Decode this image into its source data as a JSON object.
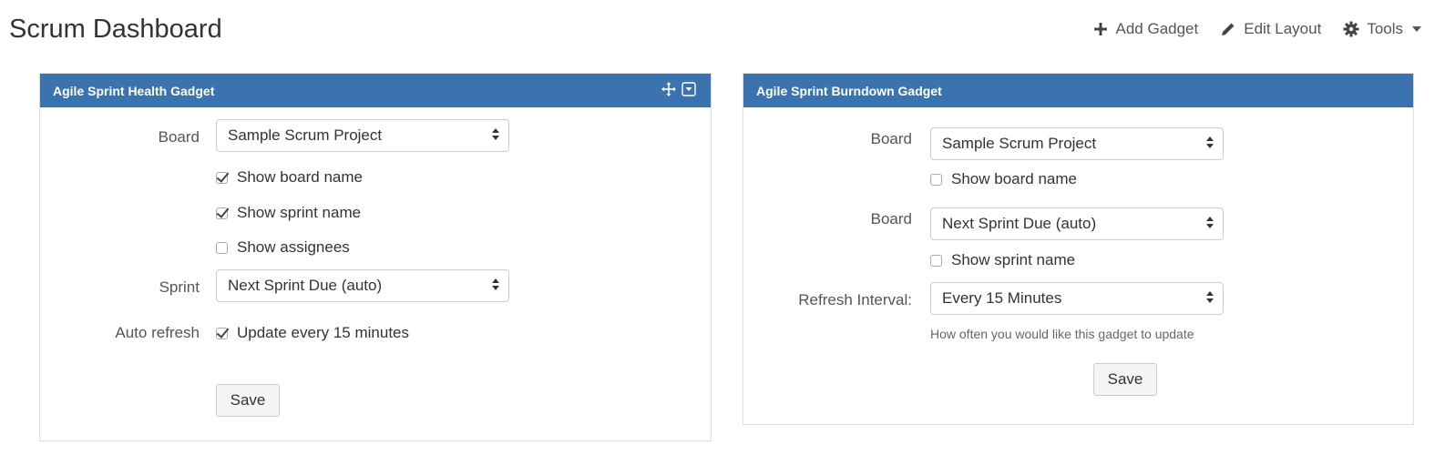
{
  "header": {
    "title": "Scrum Dashboard",
    "add_gadget": "Add Gadget",
    "edit_layout": "Edit Layout",
    "tools": "Tools"
  },
  "health_gadget": {
    "title": "Agile Sprint Health Gadget",
    "board_label": "Board",
    "board_value": "Sample Scrum Project",
    "show_board_name": "Show board name",
    "show_board_name_checked": true,
    "show_sprint_name": "Show sprint name",
    "show_sprint_name_checked": true,
    "show_assignees": "Show assignees",
    "show_assignees_checked": false,
    "sprint_label": "Sprint",
    "sprint_value": "Next Sprint Due (auto)",
    "auto_refresh_label": "Auto refresh",
    "auto_refresh_text": "Update every 15 minutes",
    "auto_refresh_checked": true,
    "save": "Save"
  },
  "burndown_gadget": {
    "title": "Agile Sprint Burndown Gadget",
    "board_label": "Board",
    "board_value": "Sample Scrum Project",
    "show_board_name": "Show board name",
    "show_board_name_checked": false,
    "board2_label": "Board",
    "board2_value": "Next Sprint Due (auto)",
    "show_sprint_name": "Show sprint name",
    "show_sprint_name_checked": false,
    "refresh_label": "Refresh Interval:",
    "refresh_value": "Every 15 Minutes",
    "refresh_help": "How often you would like this gadget to update",
    "save": "Save"
  },
  "colors": {
    "header_blue": "#3b73af"
  }
}
